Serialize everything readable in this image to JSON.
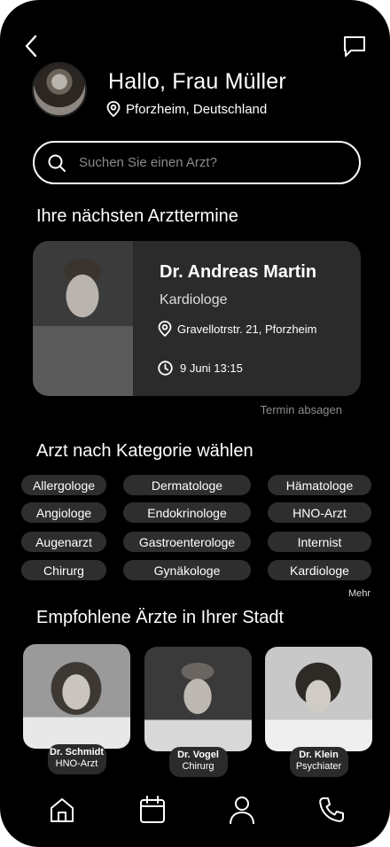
{
  "header": {
    "greeting": "Hallo, Frau Müller",
    "location": "Pforzheim, Deutschland"
  },
  "search": {
    "placeholder": "Suchen Sie einen Arzt?"
  },
  "sections": {
    "appointments": "Ihre nächsten Arzttermine",
    "categories": "Arzt nach Kategorie wählen",
    "recommended": "Empfohlene Ärzte in Ihrer Stadt"
  },
  "appointment": {
    "name": "Dr. Andreas Martin",
    "specialty": "Kardiologe",
    "address": "Gravellotrstr. 21, Pforzheim",
    "datetime": "9 Juni 13:15",
    "cancel_label": "Termin absagen"
  },
  "categories": [
    "Allergologe",
    "Dermatologe",
    "Hämatologe",
    "Angiologe",
    "Endokrinologe",
    "HNO-Arzt",
    "Augenarzt",
    "Gastroenterologe",
    "Internist",
    "Chirurg",
    "Gynäkologe",
    "Kardiologe"
  ],
  "more_label": "Mehr",
  "recommended": [
    {
      "name": "Dr. Schmidt",
      "specialty": "HNO-Arzt"
    },
    {
      "name": "Dr. Vogel",
      "specialty": "Chirurg"
    },
    {
      "name": "Dr. Klein",
      "specialty": "Psychiater"
    }
  ],
  "nav": [
    "home-icon",
    "calendar-icon",
    "profile-icon",
    "phone-icon"
  ],
  "colors": {
    "background": "#000000",
    "card": "#2b2b2b",
    "chip": "#2e2e2e",
    "muted": "#8d8d8d"
  }
}
